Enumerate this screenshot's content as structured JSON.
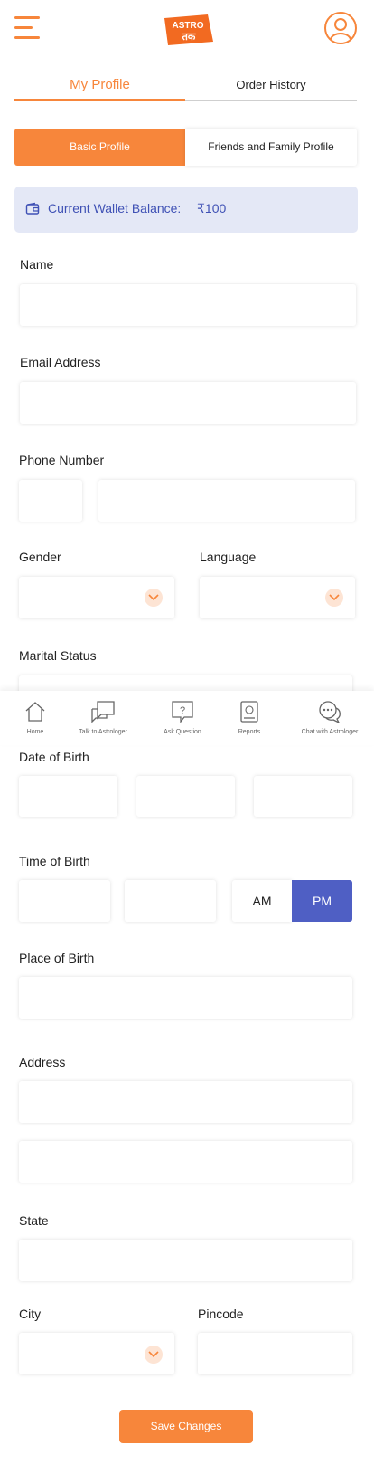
{
  "header": {
    "logo_line1": "ASTRO",
    "logo_line2": "तक"
  },
  "tabs": {
    "my_profile": "My Profile",
    "order_history": "Order History"
  },
  "segment": {
    "basic": "Basic Profile",
    "friends": "Friends and Family Profile"
  },
  "wallet": {
    "label": "Current Wallet Balance:",
    "amount": "₹100"
  },
  "form": {
    "name_label": "Name",
    "email_label": "Email Address",
    "phone_label": "Phone Number",
    "gender_label": "Gender",
    "language_label": "Language",
    "marital_label": "Marital Status",
    "dob_label": "Date of Birth",
    "tob_label": "Time of Birth",
    "am": "AM",
    "pm": "PM",
    "pm_selected": true,
    "pob_label": "Place of Birth",
    "address_label": "Address",
    "state_label": "State",
    "city_label": "City",
    "pincode_label": "Pincode",
    "save_label": "Save Changes"
  },
  "bottom_nav": [
    {
      "label": "Home",
      "icon": "home-icon"
    },
    {
      "label": "Talk to Astrologer",
      "icon": "chat-bubble-icon"
    },
    {
      "label": "Ask Question",
      "icon": "question-icon"
    },
    {
      "label": "Reports",
      "icon": "report-book-icon"
    },
    {
      "label": "Chat with Astrologer",
      "icon": "chat-dots-icon"
    }
  ],
  "colors": {
    "accent": "#f7863b",
    "wallet_bg": "#e4e8f6",
    "wallet_text": "#3f51b5",
    "pm_bg": "#4f5fc4"
  }
}
